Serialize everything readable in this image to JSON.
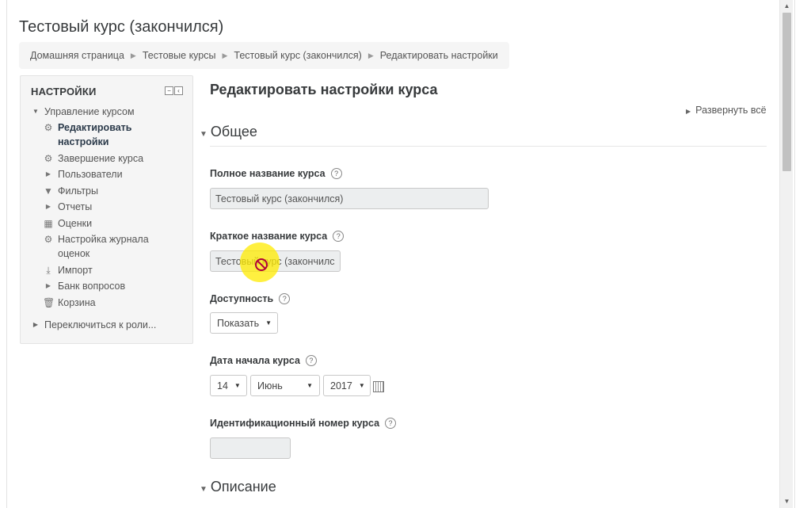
{
  "header": {
    "title": "Тестовый курс (закончился)",
    "breadcrumb": [
      "Домашняя страница",
      "Тестовые курсы",
      "Тестовый курс (закончился)",
      "Редактировать настройки"
    ]
  },
  "settings_block": {
    "title": "НАСТРОЙКИ",
    "root_label": "Управление курсом",
    "items": [
      {
        "label": "Редактировать",
        "label2": "настройки",
        "icon": "gear-icon"
      },
      {
        "label": "Завершение курса",
        "icon": "gear-icon"
      },
      {
        "label": "Пользователи",
        "icon": "arrow-right-icon"
      },
      {
        "label": "Фильтры",
        "icon": "filter-icon"
      },
      {
        "label": "Отчеты",
        "icon": "arrow-right-icon"
      },
      {
        "label": "Оценки",
        "icon": "grades-table-icon"
      },
      {
        "label": "Настройка журнала",
        "label2": "оценок",
        "icon": "gear-icon"
      },
      {
        "label": "Импорт",
        "icon": "import-icon"
      },
      {
        "label": "Банк вопросов",
        "icon": "arrow-right-icon"
      },
      {
        "label": "Корзина",
        "icon": "trash-icon"
      }
    ],
    "switch_role": "Переключиться к роли..."
  },
  "main": {
    "heading": "Редактировать настройки курса",
    "expand_all": "Развернуть всё",
    "section_general": "Общее",
    "section_description": "Описание",
    "fields": {
      "fullname_label": "Полное название курса",
      "fullname_value": "Тестовый курс (закончился)",
      "shortname_label": "Краткое название курса",
      "shortname_value": "Тестовый курс (закончился)",
      "visibility_label": "Доступность",
      "visibility_value": "Показать",
      "startdate_label": "Дата начала курса",
      "start_day": "14",
      "start_month": "Июнь",
      "start_year": "2017",
      "idnumber_label": "Идентификационный номер курса",
      "idnumber_value": ""
    },
    "help_symbol": "?"
  }
}
